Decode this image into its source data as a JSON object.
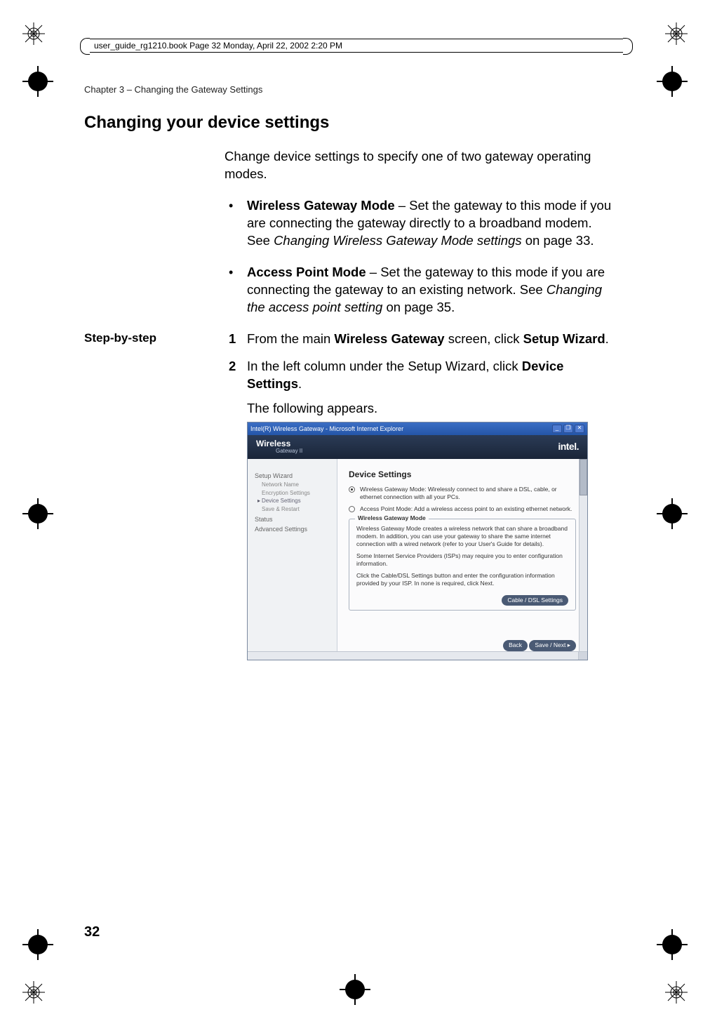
{
  "running_head": "user_guide_rg1210.book  Page 32  Monday, April 22, 2002  2:20 PM",
  "chapter_line": "Chapter 3  –  Changing the Gateway Settings",
  "section_title": "Changing your device settings",
  "intro": "Change device settings to specify one of two gateway operating modes.",
  "bullets": [
    {
      "bold": "Wireless Gateway Mode",
      "rest": " – Set the gateway to this mode if you are connecting the gateway directly to a broadband modem. See ",
      "ital": "Changing Wireless Gateway Mode settings",
      "tail": " on page 33."
    },
    {
      "bold": "Access Point Mode",
      "rest": " – Set the gateway to this mode if you are connecting the gateway to an existing network. See ",
      "ital": "Changing the access point setting",
      "tail": " on page 35."
    }
  ],
  "step_label": "Step-by-step",
  "steps": [
    {
      "num": "1",
      "pre": "From the main ",
      "bold": "Wireless Gateway",
      "mid": " screen, click ",
      "bold2": "Setup Wizard",
      "post": "."
    },
    {
      "num": "2",
      "pre": "In the left column under the Setup Wizard, click ",
      "bold": "Device Settings",
      "mid": "",
      "bold2": "",
      "post": ".",
      "after": "The following appears."
    }
  ],
  "page_number": "32",
  "screenshot": {
    "titlebar": "Intel(R) Wireless Gateway - Microsoft Internet Explorer",
    "win_min": "_",
    "win_max": "❐",
    "win_close": "✕",
    "brand": "Wireless",
    "brand_sub": "Gateway II",
    "brand_right": "intel.",
    "sidebar": {
      "setup": "Setup Wizard",
      "items": [
        "Network Name",
        "Encryption Settings",
        "Device Settings",
        "Save & Restart"
      ],
      "pointer": "▸",
      "status": "Status",
      "advanced": "Advanced Settings"
    },
    "main": {
      "heading": "Device Settings",
      "radio1": "Wireless Gateway Mode: Wirelessly connect to and share a DSL, cable, or ethernet connection with all your PCs.",
      "radio2": "Access Point Mode: Add a wireless access point to an existing ethernet network.",
      "fieldset": {
        "legend": "Wireless Gateway Mode",
        "p1": "Wireless Gateway Mode creates a wireless network that can share a broadband modem. In addition, you can use your gateway to share the same internet connection with a wired network (refer to your User's Guide for details).",
        "p2": "Some Internet Service Providers (ISPs) may require you to enter configuration information.",
        "p3": "Click the Cable/DSL Settings button and enter the configuration information provided by your ISP. In none is required, click Next.",
        "btn": "Cable / DSL Settings"
      },
      "back": "Back",
      "next": "Save / Next  ▸"
    }
  }
}
